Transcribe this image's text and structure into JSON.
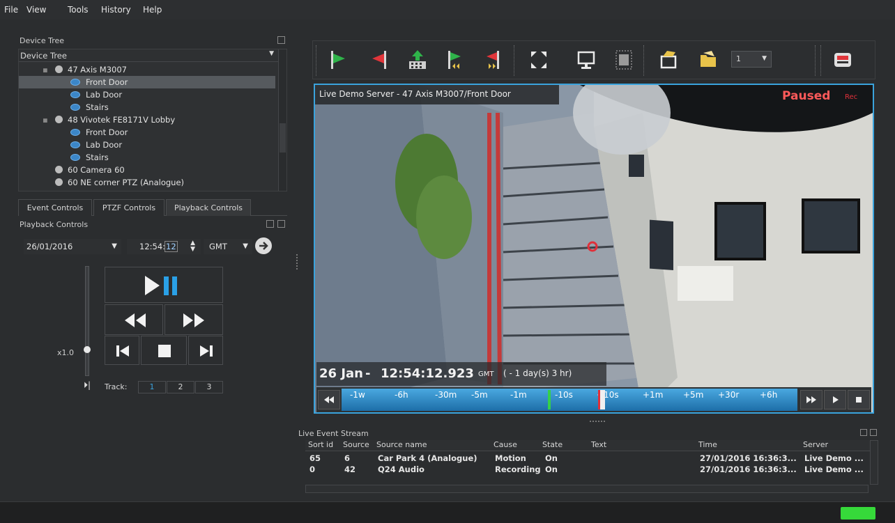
{
  "menu": [
    "File",
    "View",
    "Tools",
    "History",
    "Help"
  ],
  "device_tree": {
    "panel_title": "Device Tree",
    "dropdown_value": "Device Tree",
    "items": [
      {
        "label": "47 Axis M3007",
        "kind": "camera",
        "level": 1
      },
      {
        "label": "Front Door",
        "kind": "view",
        "level": 2,
        "selected": true
      },
      {
        "label": "Lab Door",
        "kind": "view",
        "level": 2
      },
      {
        "label": "Stairs",
        "kind": "view",
        "level": 2
      },
      {
        "label": "48 Vivotek FE8171V Lobby",
        "kind": "camera",
        "level": 1
      },
      {
        "label": "Front Door",
        "kind": "view",
        "level": 2
      },
      {
        "label": "Lab Door",
        "kind": "view",
        "level": 2
      },
      {
        "label": "Stairs",
        "kind": "view",
        "level": 2
      },
      {
        "label": "60 Camera 60",
        "kind": "camera",
        "level": 1
      },
      {
        "label": "60 NE corner PTZ (Analogue)",
        "kind": "camera",
        "level": 1
      }
    ]
  },
  "tabs": [
    "Event Controls",
    "PTZF Controls",
    "Playback Controls"
  ],
  "playback": {
    "title": "Playback Controls",
    "date": "26/01/2016",
    "time_prefix": "12:54:",
    "time_seconds": "12",
    "timezone": "GMT",
    "speed": "x1.0",
    "speed_level": 0.5,
    "track_label": "Track:",
    "tracks": [
      "1",
      "2",
      "3"
    ]
  },
  "toolbar": {
    "camera_selector_value": "1"
  },
  "video": {
    "title": "Live Demo Server - 47 Axis M3007/Front Door",
    "status": "Paused",
    "rec": "Rec",
    "timestamp_date": "26 Jan",
    "timestamp_sep": " - ",
    "timestamp_time": "12:54:12.923",
    "timestamp_tz": "GMT",
    "timestamp_offset": "( - 1 day(s) 3 hr)",
    "timeline_ticks": [
      "-1w",
      "-6h",
      "-30m",
      "-5m",
      "-1m",
      "-10s",
      "+10s",
      "+1m",
      "+5m",
      "+30r",
      "+6h"
    ]
  },
  "events": {
    "title": "Live Event Stream",
    "columns": [
      "Sort id",
      "Source",
      "Source name",
      "Cause",
      "State",
      "Text",
      "Time",
      "Server"
    ],
    "rows": [
      [
        "65",
        "6",
        "Car Park 4 (Analogue)",
        "Motion",
        "On",
        "",
        "27/01/2016 16:36:3...",
        "Live Demo ..."
      ],
      [
        "0",
        "42",
        "Q24 Audio",
        "Recording",
        "On",
        "",
        "27/01/2016 16:36:3...",
        "Live Demo ..."
      ]
    ]
  },
  "colors": {
    "accent_blue": "#3aa3dd",
    "paused_red": "#ff5a5a",
    "status_green": "#36d93a"
  }
}
